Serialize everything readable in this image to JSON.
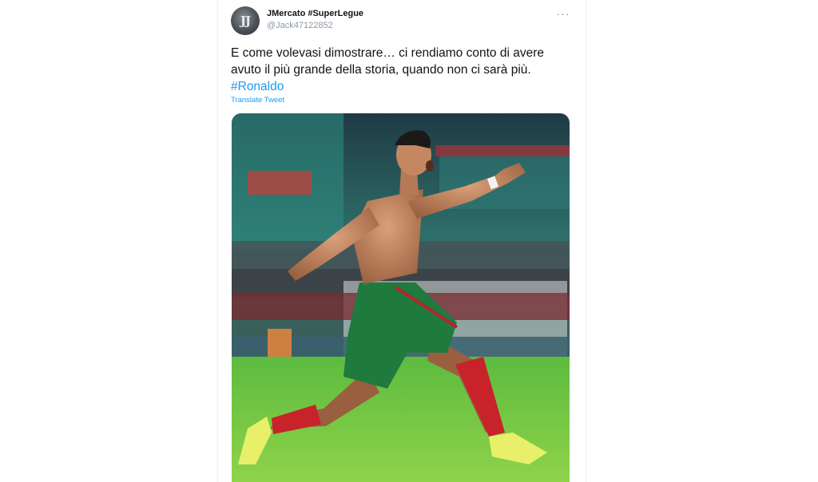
{
  "tweet": {
    "author": {
      "display_name": "JMercato #SuperLegue",
      "handle": "@Jack47122852"
    },
    "more_label": "···",
    "text_main": "E come volevasi dimostrare… ci rendiamo conto di avere avuto il più grande della storia, quando non ci sarà più. ",
    "hashtag": "#Ronaldo",
    "translate_label": "Translate Tweet"
  },
  "colors": {
    "accent": "#1d9bf0",
    "text": "#0f1419",
    "muted": "#8b98a5"
  },
  "icons": {
    "more": "more-horizontal-icon",
    "avatar": "avatar-image"
  }
}
